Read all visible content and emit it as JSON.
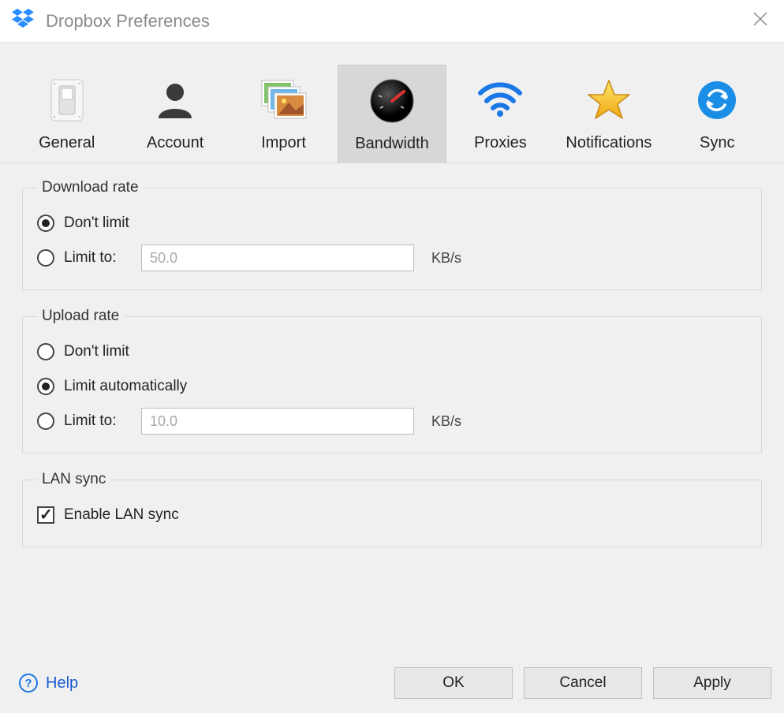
{
  "window": {
    "title": "Dropbox Preferences"
  },
  "tabs": [
    {
      "label": "General",
      "icon": "switch-icon",
      "active": false
    },
    {
      "label": "Account",
      "icon": "person-icon",
      "active": false
    },
    {
      "label": "Import",
      "icon": "photos-icon",
      "active": false
    },
    {
      "label": "Bandwidth",
      "icon": "gauge-icon",
      "active": true
    },
    {
      "label": "Proxies",
      "icon": "wifi-icon",
      "active": false
    },
    {
      "label": "Notifications",
      "icon": "star-icon",
      "active": false
    },
    {
      "label": "Sync",
      "icon": "sync-icon",
      "active": false
    }
  ],
  "download": {
    "legend": "Download rate",
    "dont_limit_label": "Don't limit",
    "limit_to_label": "Limit to:",
    "value": "50.0",
    "unit": "KB/s",
    "selected": "dont_limit"
  },
  "upload": {
    "legend": "Upload rate",
    "dont_limit_label": "Don't limit",
    "limit_auto_label": "Limit automatically",
    "limit_to_label": "Limit to:",
    "value": "10.0",
    "unit": "KB/s",
    "selected": "limit_auto"
  },
  "lan": {
    "legend": "LAN sync",
    "enable_label": "Enable LAN sync",
    "checked": true
  },
  "buttons": {
    "help": "Help",
    "ok": "OK",
    "cancel": "Cancel",
    "apply": "Apply"
  }
}
